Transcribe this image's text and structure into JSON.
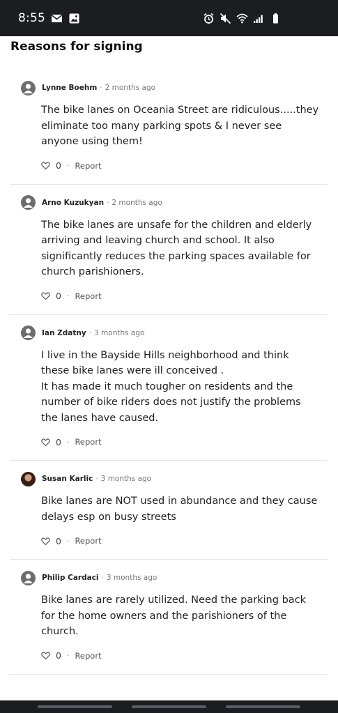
{
  "status_bar": {
    "time": "8:55",
    "left_icons": [
      "mail-icon",
      "image-icon"
    ],
    "right_icons": [
      "alarm-icon",
      "mute-icon",
      "wifi-icon",
      "signal-icon",
      "battery-icon"
    ]
  },
  "section": {
    "title": "Reasons for signing"
  },
  "comments": [
    {
      "author": "Lynne Boehm",
      "time": "2 months ago",
      "text": "The bike lanes on Oceania Street are ridiculous.....they eliminate too many parking spots & I never see anyone using them!",
      "likes": "0",
      "report": "Report",
      "avatar": "default-avatar-icon"
    },
    {
      "author": "Arno Kuzukyan",
      "time": "2 months ago",
      "text": "The bike lanes are unsafe for the children and elderly arriving and leaving church and school. It also significantly reduces the parking spaces available for church parishioners.",
      "likes": "0",
      "report": "Report",
      "avatar": "default-avatar-icon"
    },
    {
      "author": "Ian Zdatny",
      "time": "3 months ago",
      "text": "I live in the Bayside Hills neighborhood and think these bike lanes were ill conceived .\nIt has made it much tougher on residents and the number of bike riders does not justify the problems the lanes have caused.",
      "likes": "0",
      "report": "Report",
      "avatar": "default-avatar-icon"
    },
    {
      "author": "Susan Karlic",
      "time": "3 months ago",
      "text": "Bike lanes are NOT used in abundance and they cause delays esp on busy streets",
      "likes": "0",
      "report": "Report",
      "avatar": "photo-avatar"
    },
    {
      "author": "Philip Cardaci",
      "time": "3 months ago",
      "text": "Bike lanes are rarely utilized. Need the parking back for the home owners and the parishioners of the church.",
      "likes": "0",
      "report": "Report",
      "avatar": "default-avatar-icon"
    }
  ],
  "colors": {
    "status_bar": "#1c1d21",
    "divider": "#e4e4e4",
    "avatar": "#6d6d6d"
  }
}
